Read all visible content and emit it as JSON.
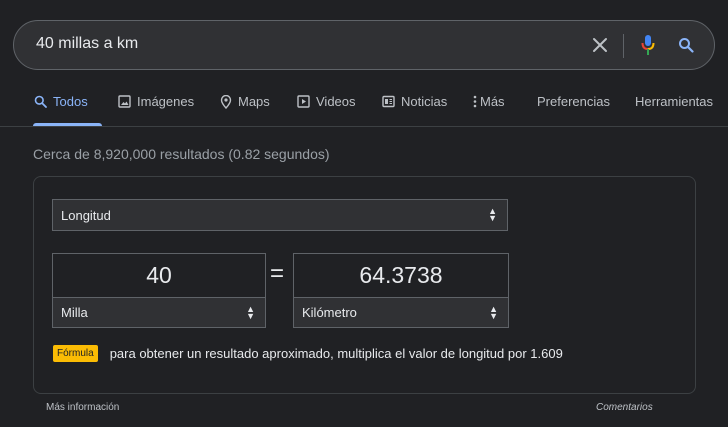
{
  "search": {
    "query": "40 millas a km"
  },
  "tabs": [
    {
      "label": "Todos",
      "icon": "search-icon",
      "active": true
    },
    {
      "label": "Imágenes",
      "icon": "image-icon"
    },
    {
      "label": "Maps",
      "icon": "map-pin-icon"
    },
    {
      "label": "Videos",
      "icon": "play-icon"
    },
    {
      "label": "Noticias",
      "icon": "news-icon"
    },
    {
      "label": "Más",
      "icon": "more-vert-icon"
    },
    {
      "label": "Preferencias"
    },
    {
      "label": "Herramientas"
    }
  ],
  "result_stats": "Cerca de 8,920,000 resultados (0.82 segundos)",
  "converter": {
    "category": "Longitud",
    "from_value": "40",
    "to_value": "64.3738",
    "equals": "=",
    "from_unit": "Milla",
    "to_unit": "Kilómetro",
    "formula_label": "Fórmula",
    "formula_text": "para obtener un resultado aproximado, multiplica el valor de longitud por 1.609"
  },
  "footer": {
    "more_info": "Más información",
    "feedback": "Comentarios"
  },
  "colors": {
    "background": "#202124",
    "accent": "#8ab4f8",
    "formula_badge": "#fbbc04",
    "mic_blue": "#4285f4",
    "mic_red": "#ea4335",
    "mic_yellow": "#fbbc04",
    "mic_green": "#34a853"
  }
}
